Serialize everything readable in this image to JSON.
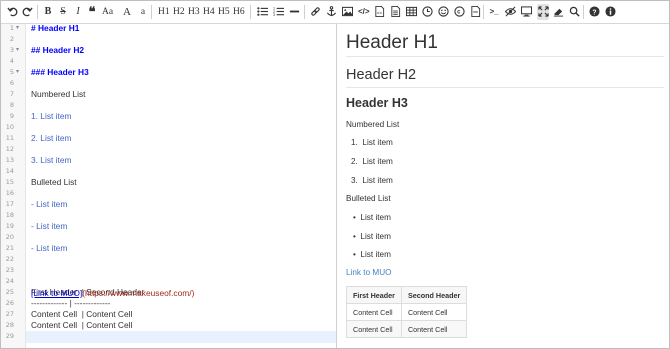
{
  "toolbar": {
    "headings": [
      "H1",
      "H2",
      "H3",
      "H4",
      "H5",
      "H6"
    ],
    "case_upper": "Aa",
    "case_size_up": "A",
    "case_lower": "a"
  },
  "editor": {
    "line_numbers": [
      "1",
      "2",
      "3",
      "4",
      "5",
      "6",
      "7",
      "8",
      "9",
      "10",
      "11",
      "12",
      "13",
      "14",
      "15",
      "16",
      "17",
      "18",
      "19",
      "20",
      "21",
      "22",
      "23",
      "24",
      "25",
      "26",
      "27",
      "28",
      "29"
    ],
    "folds": [
      "1",
      "3",
      "5"
    ],
    "lines": [
      {
        "n": 1,
        "kind": "hdr",
        "text": "# Header H1"
      },
      {
        "n": 3,
        "kind": "hdr",
        "text": "## Header H2"
      },
      {
        "n": 5,
        "kind": "hdr",
        "text": "### Header H3"
      },
      {
        "n": 7,
        "kind": "plain",
        "text": "Numbered List"
      },
      {
        "n": 9,
        "kind": "list",
        "text": "1. List item"
      },
      {
        "n": 11,
        "kind": "list",
        "text": "2. List item"
      },
      {
        "n": 13,
        "kind": "list",
        "text": "3. List item"
      },
      {
        "n": 15,
        "kind": "plain",
        "text": "Bulleted List"
      },
      {
        "n": 17,
        "kind": "list",
        "text": "- List item"
      },
      {
        "n": 19,
        "kind": "list",
        "text": "- List item"
      },
      {
        "n": 21,
        "kind": "list",
        "text": "- List item"
      },
      {
        "n": 25,
        "kind": "plain",
        "text": "First Header  | Second Header"
      },
      {
        "n": 26,
        "kind": "plain",
        "text": "------------- | -------------"
      },
      {
        "n": 27,
        "kind": "plain",
        "text": "Content Cell  | Content Cell"
      },
      {
        "n": 28,
        "kind": "plain",
        "text": "Content Cell  | Content Cell"
      }
    ],
    "link_line": {
      "n": 23,
      "text": "[Link to MUO]",
      "url": "(https://www.makeuseof.com/)"
    }
  },
  "preview": {
    "h1": "Header H1",
    "h2": "Header H2",
    "h3": "Header H3",
    "numbered_title": "Numbered List",
    "numbered_items": [
      "List item",
      "List item",
      "List item"
    ],
    "bulleted_title": "Bulleted List",
    "bulleted_items": [
      "List item",
      "List item",
      "List item"
    ],
    "link": "Link to MUO",
    "table": {
      "headers": [
        "First Header",
        "Second Header"
      ],
      "rows": [
        [
          "Content Cell",
          "Content Cell"
        ],
        [
          "Content Cell",
          "Content Cell"
        ]
      ]
    }
  }
}
